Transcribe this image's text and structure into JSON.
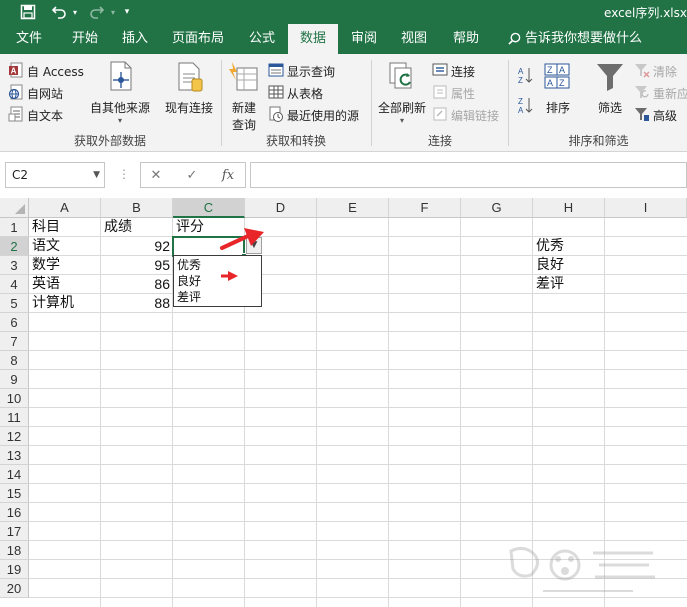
{
  "titlebar": {
    "doc_title": "excel序列.xlsx"
  },
  "tabs": [
    {
      "label": "文件"
    },
    {
      "label": "开始"
    },
    {
      "label": "插入"
    },
    {
      "label": "页面布局"
    },
    {
      "label": "公式"
    },
    {
      "label": "数据"
    },
    {
      "label": "审阅"
    },
    {
      "label": "视图"
    },
    {
      "label": "帮助"
    }
  ],
  "tellme": "告诉我你想要做什么",
  "ribbon": {
    "get_external": {
      "access": "自 Access",
      "web": "自网站",
      "text": "自文本",
      "other": "自其他来源",
      "existing": "现有连接",
      "label": "获取外部数据"
    },
    "get_transform": {
      "new_query_1": "新建",
      "new_query_2": "查询",
      "show_queries": "显示查询",
      "from_table": "从表格",
      "recent_sources": "最近使用的源",
      "label": "获取和转换"
    },
    "connections": {
      "refresh_all": "全部刷新",
      "connections": "连接",
      "properties": "属性",
      "edit_links": "编辑链接",
      "label": "连接"
    },
    "sort_filter": {
      "sort": "排序",
      "filter": "筛选",
      "clear": "清除",
      "reapply": "重新应用",
      "advanced": "高级",
      "label": "排序和筛选"
    }
  },
  "formula_bar": {
    "name_box": "C2",
    "fx": "fx",
    "formula": ""
  },
  "columns": [
    "A",
    "B",
    "C",
    "D",
    "E",
    "F",
    "G",
    "H",
    "I"
  ],
  "selected_column": "C",
  "rows": [
    "1",
    "2",
    "3",
    "4",
    "5",
    "6",
    "7",
    "8",
    "9",
    "10",
    "11",
    "12",
    "13",
    "14",
    "15",
    "16",
    "17",
    "18",
    "19",
    "20"
  ],
  "selected_row": "2",
  "cells": {
    "A1": "科目",
    "B1": "成绩",
    "C1": "评分",
    "A2": "语文",
    "B2": "92",
    "A3": "数学",
    "B3": "95",
    "A4": "英语",
    "B4": "86",
    "A5": "计算机",
    "B5": "88",
    "H2": "优秀",
    "H3": "良好",
    "H4": "差评"
  },
  "dropdown": {
    "options": [
      "优秀",
      "良好",
      "差评"
    ]
  },
  "colors": {
    "excel_green": "#217346",
    "annotation_red": "#e8262a"
  }
}
